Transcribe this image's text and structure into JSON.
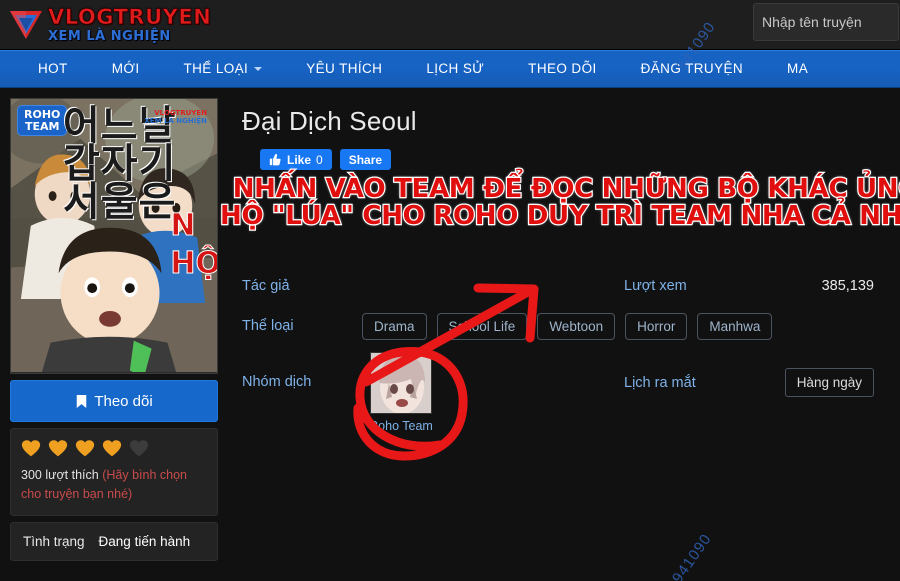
{
  "site": {
    "logo_main": "VLOGTRUYEN",
    "logo_sub": "XEM LÀ NGHIỆN",
    "logo_icon": "v-triangle-logo-icon"
  },
  "search": {
    "placeholder": "Nhập tên truyện",
    "value": ""
  },
  "nav": {
    "items": [
      {
        "label": "HOT",
        "has_caret": false
      },
      {
        "label": "MỚI",
        "has_caret": false
      },
      {
        "label": "THỂ LOẠI",
        "has_caret": true
      },
      {
        "label": "YÊU THÍCH",
        "has_caret": false
      },
      {
        "label": "LỊCH SỬ",
        "has_caret": false
      },
      {
        "label": "THEO DÕI",
        "has_caret": false
      },
      {
        "label": "ĐĂNG TRUYỆN",
        "has_caret": false
      },
      {
        "label": "MA",
        "has_caret": false
      }
    ]
  },
  "watermarks": {
    "top": "941090",
    "bottom": "941090"
  },
  "cover": {
    "badge_line1": "ROHO",
    "badge_line2": "TEAM",
    "korean_line1": "어느날",
    "korean_line2": "갑자기",
    "korean_line3": "서울은",
    "vlog_l1": "VLOGTRUYEN",
    "vlog_l2": "XEM LÀ NGHIỆN",
    "red_line1": "N",
    "red_line2": "HỘ"
  },
  "sidebar": {
    "follow_label": "Theo dõi",
    "follow_icon": "bookmark-icon",
    "rating_filled": 4,
    "rating_total": 5,
    "likes_text": "300 lượt thích",
    "likes_note": "(Hãy bình chọn cho truyện bạn nhé)",
    "status_label": "Tình trạng",
    "status_value": "Đang tiến hành"
  },
  "main": {
    "title": "Đại Dịch Seoul",
    "like_label": "Like",
    "like_count": "0",
    "share_label": "Share",
    "announcement_line1": "NHẤN VÀO TEAM ĐỂ ĐỌC NHỮNG BỘ KHÁC ỦNG",
    "announcement_line2": "HỘ \"LÚA\" CHO ROHO DUY TRÌ TEAM NHA CẢ NHÀ!!",
    "author_label": "Tác giả",
    "author_value": "",
    "views_label": "Lượt xem",
    "views_value": "385,139",
    "genre_label": "Thể loại",
    "genres": [
      "Drama",
      "School Life",
      "Webtoon",
      "Horror",
      "Manhwa"
    ],
    "team_label": "Nhóm dịch",
    "team_name": "Roho Team",
    "schedule_label": "Lịch ra mắt",
    "schedule_value": "Hàng ngày"
  },
  "colors": {
    "nav_blue": "#1763c4",
    "accent_blue": "#7fb2e8",
    "announce_red": "#e10e0e",
    "heart_gold": "#f0a020",
    "facebook_blue": "#1877f2"
  }
}
